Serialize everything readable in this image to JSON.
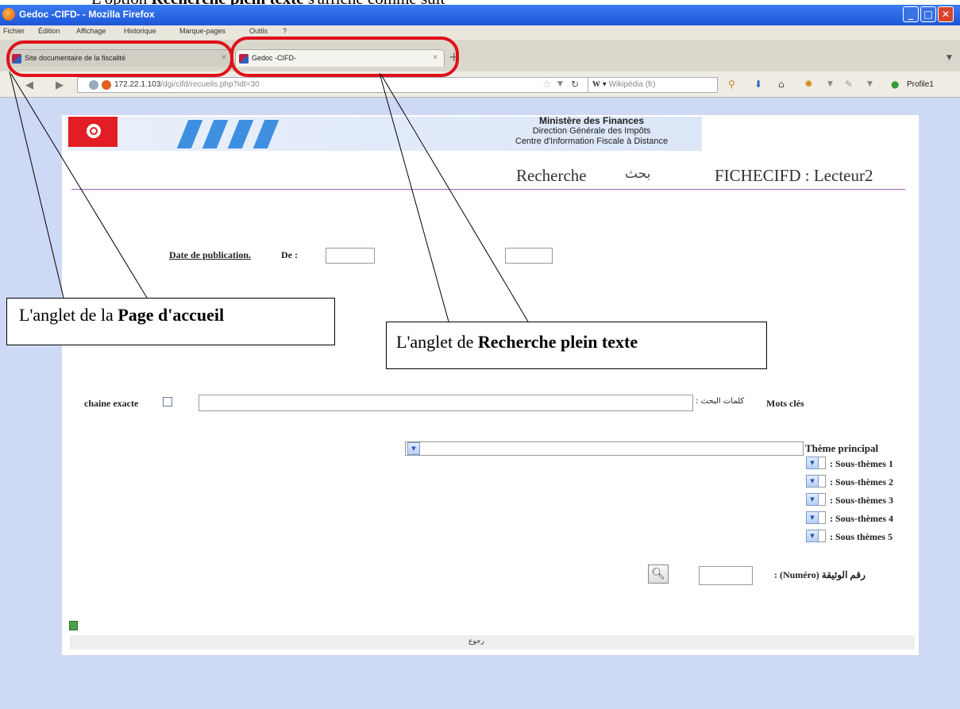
{
  "doc_caption": {
    "prefix": "L'option ",
    "bold": "Recherche plein texte",
    "suffix": " s'affiche comme suit"
  },
  "window": {
    "title": "Gedoc -CIFD- - Mozilla Firefox"
  },
  "menu": [
    "Fichier",
    "Édition",
    "Affichage",
    "Historique",
    "Marque-pages",
    "Outils",
    "?"
  ],
  "tabs": [
    {
      "label": "Site documentaire de la fiscalité"
    },
    {
      "label": "Gedoc -CIFD-"
    }
  ],
  "url": {
    "host": "172.22.1.103",
    "path": "/dgi/cifd/recueils.php?idt=30"
  },
  "search": {
    "engine": "W",
    "placeholder": "Wikipédia (fr)"
  },
  "toolbar": {
    "profile_label": "Profile1"
  },
  "icons": [
    "back-arrow-icon",
    "forward-arrow-icon",
    "globe-icon",
    "warning-icon",
    "star-icon",
    "reload-icon",
    "magnifier-icon",
    "download-icon",
    "home-icon",
    "addon-icon",
    "profile-icon",
    "search-icon"
  ],
  "header": {
    "line1": "Ministère des Finances",
    "line2": "Direction Générale des Impôts",
    "line3": "Centre d'Information Fiscale à Distance",
    "recherche": "Recherche",
    "bahth": "بحث",
    "user": "FICHECIFD : Lecteur2"
  },
  "form": {
    "date_label": "Date de publication.",
    "date_from_label": "De :",
    "exact_label": "chaine exacte",
    "keywords_arabic": ": كلمات البحث",
    "keywords_label": "Mots clés",
    "theme_label": "Thème principal",
    "sub_themes": [
      ": Sous-thèmes 1",
      ": Sous-thèmes 2",
      ": Sous-thèmes 3",
      ": Sous-thèmes 4",
      ": Sous thèmes 5"
    ],
    "numero_label": ": (Numéro) رقم الوثيقة"
  },
  "footer": {
    "text": "رجوع"
  },
  "callouts": {
    "tab1_prefix": "L'anglet de la ",
    "tab1_bold": "Page d'accueil",
    "tab2_prefix": "L'anglet de ",
    "tab2_bold": "Recherche plein texte"
  },
  "colors": {
    "annotation": "#e0101a",
    "header_stripe": "#3f8fe0",
    "flag": "#e21d23",
    "divider": "#a060b0"
  }
}
